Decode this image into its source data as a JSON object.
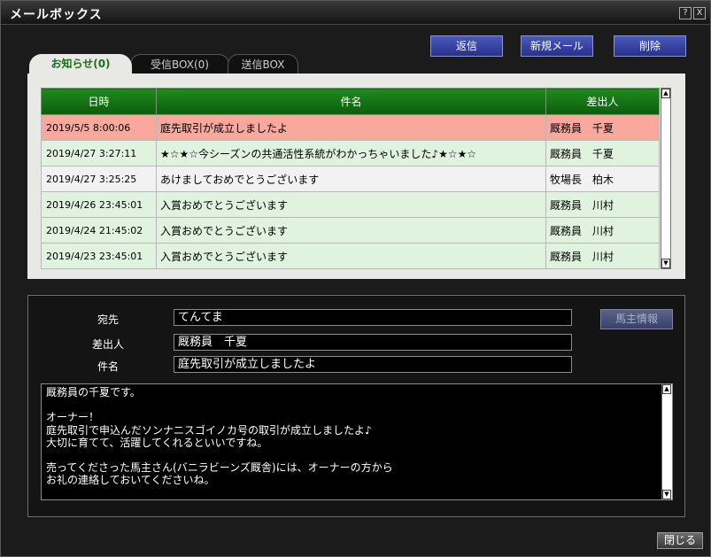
{
  "window": {
    "title": "メールボックス",
    "help_label": "?",
    "close_label": "X"
  },
  "actions": {
    "reply": "返信",
    "new_mail": "新規メール",
    "delete": "削除"
  },
  "tabs": [
    {
      "label": "お知らせ(0)"
    },
    {
      "label": "受信BOX(0)"
    },
    {
      "label": "送信BOX"
    }
  ],
  "table": {
    "headers": {
      "date": "日時",
      "subject": "件名",
      "sender": "差出人"
    },
    "rows": [
      {
        "date": "2019/5/5 8:00:06",
        "subject": "庭先取引が成立しましたよ",
        "sender": "厩務員　千夏"
      },
      {
        "date": "2019/4/27 3:27:11",
        "subject": "★☆★☆今シーズンの共通活性系統がわかっちゃいました♪★☆★☆",
        "sender": "厩務員　千夏"
      },
      {
        "date": "2019/4/27 3:25:25",
        "subject": "あけましておめでとうございます",
        "sender": "牧場長　柏木"
      },
      {
        "date": "2019/4/26 23:45:01",
        "subject": "入賞おめでとうございます",
        "sender": "厩務員　川村"
      },
      {
        "date": "2019/4/24 21:45:02",
        "subject": "入賞おめでとうございます",
        "sender": "厩務員　川村"
      },
      {
        "date": "2019/4/23 23:45:01",
        "subject": "入賞おめでとうございます",
        "sender": "厩務員　川村"
      }
    ]
  },
  "detail": {
    "to_label": "宛先",
    "to_value": "てんてま",
    "from_label": "差出人",
    "from_value": "厩務員　千夏",
    "subject_label": "件名",
    "subject_value": "庭先取引が成立しましたよ",
    "owner_info_button": "馬主情報",
    "body": "厩務員の千夏です。\n\nオーナー！\n庭先取引で申込んだソンナニスゴイノカ号の取引が成立しましたよ♪\n大切に育てて、活躍してくれるといいですね。\n\n売ってくださった馬主さん(バニラビーンズ厩舎)には、オーナーの方から\nお礼の連絡しておいてくださいね。"
  },
  "footer": {
    "close_label": "閉じる"
  }
}
